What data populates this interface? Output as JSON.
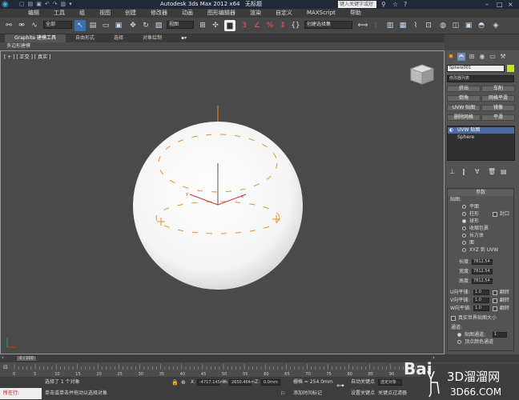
{
  "titlebar": {
    "app_title": "Autodesk 3ds Max  2012 x64",
    "file_name": "无标题",
    "search_placeholder": "键入关键字或短语"
  },
  "menu": [
    "编辑",
    "工具",
    "组",
    "视图",
    "创建",
    "修改器",
    "动画",
    "图形编辑器",
    "渲染",
    "自定义",
    "MAXScript",
    "帮助"
  ],
  "toolbar": {
    "selection_filter": "全部",
    "ref_coord": "视图",
    "named_selection": "创建选择集"
  },
  "ribbon": {
    "tabs": [
      "Graphite 建模工具",
      "自由形式",
      "选择",
      "对象绘制"
    ],
    "active_tab": 0,
    "sub_label": "多边形建模"
  },
  "viewport": {
    "label": "[ + ] [ 正交 ] [ 真实 ]"
  },
  "command_panel": {
    "object_name": "Sphere001",
    "modifier_list": "修改器列表",
    "buttons": [
      "挤出",
      "车削",
      "倒角",
      "网格平滑",
      "UVW 贴图",
      "镜像",
      "删除网格",
      "平滑"
    ],
    "stack": [
      "UVW 贴图",
      "Sphere"
    ],
    "rollout_title": "参数",
    "mapping_label": "贴图:",
    "mapping_options": [
      "平面",
      "柱形",
      "球形",
      "收缩包裹",
      "长方体",
      "面",
      "XYZ 到 UVW"
    ],
    "selected_mapping": 2,
    "cap_label": "封口",
    "dims": [
      {
        "label": "长度:",
        "value": "7812.54"
      },
      {
        "label": "宽度:",
        "value": "7812.54"
      },
      {
        "label": "高度:",
        "value": "7812.54"
      }
    ],
    "tiles": [
      {
        "label": "U向平铺:",
        "value": "1.0",
        "flip": "翻转"
      },
      {
        "label": "V向平铺:",
        "value": "1.0",
        "flip": "翻转"
      },
      {
        "label": "W向平铺:",
        "value": "1.0",
        "flip": "翻转"
      }
    ],
    "real_world": "真实世界贴图大小",
    "channel_title": "通道:",
    "map_channel": "贴图通道:",
    "map_channel_value": "1",
    "vertex_color": "顶点颜色通道"
  },
  "timebar": {
    "frame": "0 / 100"
  },
  "timeline_ticks": [
    "0",
    "5",
    "10",
    "15",
    "20",
    "25",
    "30",
    "35",
    "40",
    "45",
    "50",
    "55",
    "60",
    "65",
    "70",
    "75",
    "80",
    "85",
    "90"
  ],
  "status": {
    "selected": "选择了 1 个对象",
    "prompt": "单击或单击并拖动以选择对象",
    "x_label": "X:",
    "x_value": "-4717.145mm",
    "y_label": "Y:",
    "y_value": "2650.464m",
    "z_label": "Z:",
    "z_value": "0.0mm",
    "grid": "栅格 = 254.0mm",
    "add_time_tag": "添加时间标记",
    "auto_key": "自动关键点",
    "set_key": "设置关键点",
    "selected_obj": "选定对象",
    "key_filter": "关键点过滤器",
    "located": "所在行:"
  },
  "watermark": {
    "brand": "3D溜溜网",
    "domain": "3D66.COM"
  }
}
